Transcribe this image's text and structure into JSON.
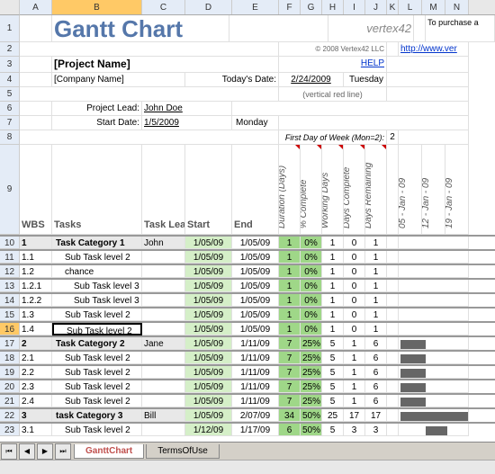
{
  "columns": [
    "A",
    "B",
    "C",
    "D",
    "E",
    "F",
    "G",
    "H",
    "I",
    "J",
    "K",
    "L",
    "M",
    "N"
  ],
  "title": "Gantt Chart",
  "logo": "vertex42",
  "copyright": "© 2008 Vertex42 LLC",
  "help_link": "HELP",
  "purchase_text": "To purchase a",
  "purchase_link": "http://www.ver",
  "project_name": "[Project Name]",
  "company_name": "[Company Name]",
  "todays_date_label": "Today's Date:",
  "todays_date": "2/24/2009",
  "day_of_week": "Tuesday",
  "vertical_note": "(vertical red line)",
  "project_lead_label": "Project Lead:",
  "project_lead": "John Doe",
  "start_date_label": "Start Date:",
  "start_date": "1/5/2009",
  "start_day": "Monday",
  "first_day_label": "First Day of Week (Mon=2):",
  "first_day_value": "2",
  "headers": {
    "wbs": "WBS",
    "tasks": "Tasks",
    "task_lead": "Task Lead",
    "start": "Start",
    "end": "End",
    "duration": "Duration (Days)",
    "pct_complete": "% Complete",
    "working_days": "Working Days",
    "days_complete": "Days Complete",
    "days_remaining": "Days Remaining"
  },
  "gantt_dates": [
    "05 - Jan - 09",
    "12 - Jan - 09",
    "19 - Jan - 09"
  ],
  "rows": [
    {
      "n": 10,
      "wbs": "1",
      "task": "Task Category 1",
      "lead": "John",
      "start": "1/05/09",
      "end": "1/05/09",
      "dur": "1",
      "pct": "0%",
      "wd": "1",
      "dc": "0",
      "dr": "1",
      "cat": true
    },
    {
      "n": 11,
      "wbs": "1.1",
      "task": "Sub Task level 2",
      "lead": "",
      "start": "1/05/09",
      "end": "1/05/09",
      "dur": "1",
      "pct": "0%",
      "wd": "1",
      "dc": "0",
      "dr": "1"
    },
    {
      "n": 12,
      "wbs": "1.2",
      "task": "chance",
      "lead": "",
      "start": "1/05/09",
      "end": "1/05/09",
      "dur": "1",
      "pct": "0%",
      "wd": "1",
      "dc": "0",
      "dr": "1"
    },
    {
      "n": 13,
      "wbs": "1.2.1",
      "task": "Sub Task level 3",
      "lead": "",
      "start": "1/05/09",
      "end": "1/05/09",
      "dur": "1",
      "pct": "0%",
      "wd": "1",
      "dc": "0",
      "dr": "1"
    },
    {
      "n": 14,
      "wbs": "1.2.2",
      "task": "Sub Task level 3",
      "lead": "",
      "start": "1/05/09",
      "end": "1/05/09",
      "dur": "1",
      "pct": "0%",
      "wd": "1",
      "dc": "0",
      "dr": "1"
    },
    {
      "n": 15,
      "wbs": "1.3",
      "task": "Sub Task level 2",
      "lead": "",
      "start": "1/05/09",
      "end": "1/05/09",
      "dur": "1",
      "pct": "0%",
      "wd": "1",
      "dc": "0",
      "dr": "1"
    },
    {
      "n": 16,
      "wbs": "1.4",
      "task": "Sub Task level 2",
      "lead": "",
      "start": "1/05/09",
      "end": "1/05/09",
      "dur": "1",
      "pct": "0%",
      "wd": "1",
      "dc": "0",
      "dr": "1",
      "selected": true
    },
    {
      "n": 17,
      "wbs": "2",
      "task": "Task Category 2",
      "lead": "Jane",
      "start": "1/05/09",
      "end": "1/11/09",
      "dur": "7",
      "pct": "25%",
      "wd": "5",
      "dc": "1",
      "dr": "6",
      "cat": true,
      "bar": 28
    },
    {
      "n": 18,
      "wbs": "2.1",
      "task": "Sub Task level 2",
      "lead": "",
      "start": "1/05/09",
      "end": "1/11/09",
      "dur": "7",
      "pct": "25%",
      "wd": "5",
      "dc": "1",
      "dr": "6",
      "bar": 28
    },
    {
      "n": 19,
      "wbs": "2.2",
      "task": "Sub Task level 2",
      "lead": "",
      "start": "1/05/09",
      "end": "1/11/09",
      "dur": "7",
      "pct": "25%",
      "wd": "5",
      "dc": "1",
      "dr": "6",
      "bar": 28
    },
    {
      "n": 20,
      "wbs": "2.3",
      "task": "Sub Task level 2",
      "lead": "",
      "start": "1/05/09",
      "end": "1/11/09",
      "dur": "7",
      "pct": "25%",
      "wd": "5",
      "dc": "1",
      "dr": "6",
      "bar": 28
    },
    {
      "n": 21,
      "wbs": "2.4",
      "task": "Sub Task level 2",
      "lead": "",
      "start": "1/05/09",
      "end": "1/11/09",
      "dur": "7",
      "pct": "25%",
      "wd": "5",
      "dc": "1",
      "dr": "6",
      "bar": 28
    },
    {
      "n": 22,
      "wbs": "3",
      "task": "task Category 3",
      "lead": "Bill",
      "start": "1/05/09",
      "end": "2/07/09",
      "dur": "34",
      "pct": "50%",
      "wd": "25",
      "dc": "17",
      "dr": "17",
      "cat": true,
      "bar": 80
    },
    {
      "n": 23,
      "wbs": "3.1",
      "task": "Sub Task level 2",
      "lead": "",
      "start": "1/12/09",
      "end": "1/17/09",
      "dur": "6",
      "pct": "50%",
      "wd": "5",
      "dc": "3",
      "dr": "3",
      "bar": 24,
      "offset": 28
    }
  ],
  "tabs": {
    "active": "GanttChart",
    "other": "TermsOfUse"
  }
}
